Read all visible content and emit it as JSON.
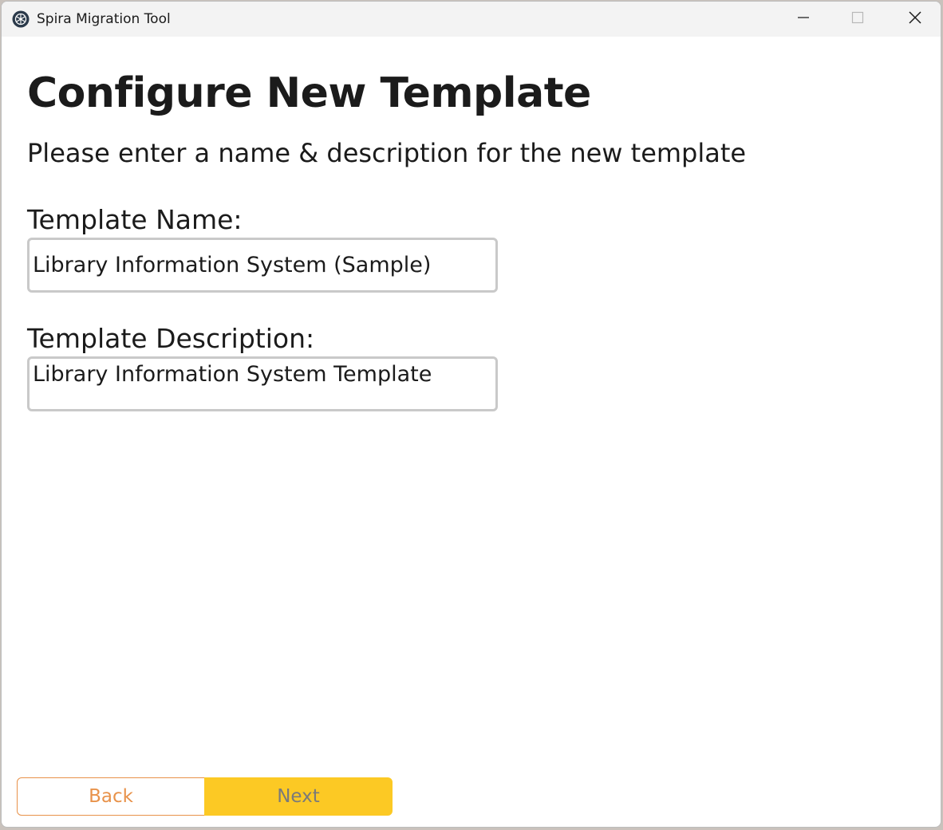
{
  "window": {
    "title": "Spira Migration Tool",
    "app_icon": "spira-logo-icon",
    "controls": {
      "minimize_icon": "minimize-icon",
      "maximize_icon": "maximize-icon",
      "close_icon": "close-icon"
    }
  },
  "page": {
    "title": "Configure New Template",
    "subtitle": "Please enter a name & description for the new template"
  },
  "form": {
    "name_label": "Template Name:",
    "name_value": "Library Information System (Sample)",
    "description_label": "Template Description:",
    "description_value": "Library Information System Template"
  },
  "footer": {
    "back_label": "Back",
    "next_label": "Next"
  },
  "colors": {
    "accent_orange": "#e8924a",
    "accent_yellow": "#fcc924",
    "titlebar_bg": "#f3f3f3",
    "text": "#1b1b1b"
  }
}
